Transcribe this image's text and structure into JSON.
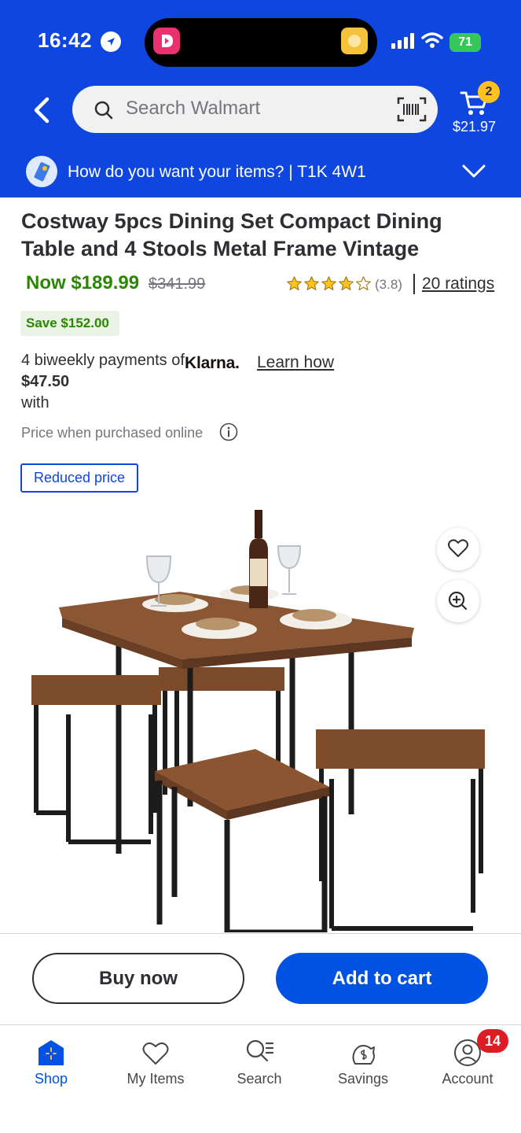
{
  "status_bar": {
    "time": "16:42",
    "battery": "71"
  },
  "header": {
    "search_placeholder": "Search Walmart",
    "cart_count": "2",
    "cart_total": "$21.97",
    "delivery_text": "How do you want your items? | T1K 4W1"
  },
  "product": {
    "title": "Costway 5pcs Dining Set Compact Dining Table and 4 Stools Metal Frame Vintage",
    "now_price": "Now $189.99",
    "was_price": "$341.99",
    "rating": 3.8,
    "rating_text": "(3.8)",
    "ratings_link": "20 ratings",
    "save_badge": "Save $152.00",
    "klarna_line1": "4 biweekly payments of ",
    "klarna_amount": "$47.50",
    "klarna_line2": " with",
    "klarna_logo": "Klarna.",
    "learn_how": "Learn how",
    "online_note": "Price when purchased online",
    "reduced_tag": "Reduced price"
  },
  "actions": {
    "buy_now": "Buy now",
    "add_to_cart": "Add to cart"
  },
  "nav": {
    "items": [
      {
        "label": "Shop",
        "icon": "shop-icon"
      },
      {
        "label": "My Items",
        "icon": "heart-icon"
      },
      {
        "label": "Search",
        "icon": "search-list-icon"
      },
      {
        "label": "Savings",
        "icon": "savings-icon"
      },
      {
        "label": "Account",
        "icon": "account-icon"
      }
    ],
    "account_badge": "14"
  },
  "colors": {
    "header_blue": "#0f46e0",
    "price_green": "#2a8703",
    "cart_button_blue": "#0053e2",
    "badge_yellow": "#ffc220",
    "alert_red": "#de1c24"
  }
}
